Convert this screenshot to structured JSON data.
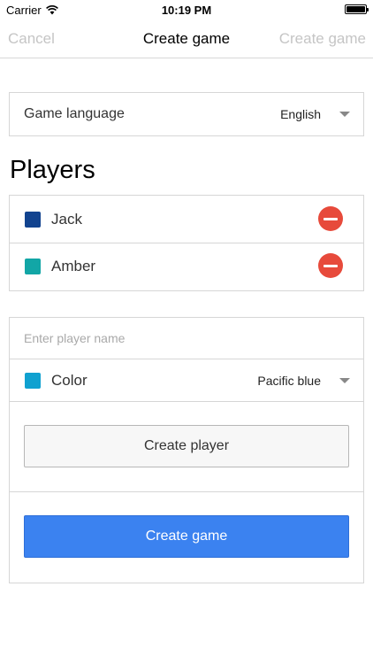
{
  "status_bar": {
    "carrier": "Carrier",
    "time": "10:19 PM",
    "battery_level": 1.0
  },
  "nav": {
    "cancel_label": "Cancel",
    "title": "Create game",
    "create_label": "Create game"
  },
  "language": {
    "label": "Game language",
    "value": "English"
  },
  "players": {
    "heading": "Players",
    "items": [
      {
        "name": "Jack",
        "color": "#12438f"
      },
      {
        "name": "Amber",
        "color": "#12a6a6"
      }
    ]
  },
  "new_player": {
    "name_placeholder": "Enter player name",
    "name_value": "",
    "color_label": "Color",
    "color_value": "Pacific blue",
    "color_swatch": "#10a1d0",
    "create_player_label": "Create player"
  },
  "footer": {
    "create_game_label": "Create game"
  },
  "colors": {
    "accent": "#3b82f0",
    "remove": "#e74a3b",
    "disabled_text": "#c5c5c5"
  },
  "icons": {
    "wifi": "wifi-icon",
    "battery": "battery-icon",
    "remove": "remove-circle-icon",
    "dropdown": "caret-down-icon"
  }
}
